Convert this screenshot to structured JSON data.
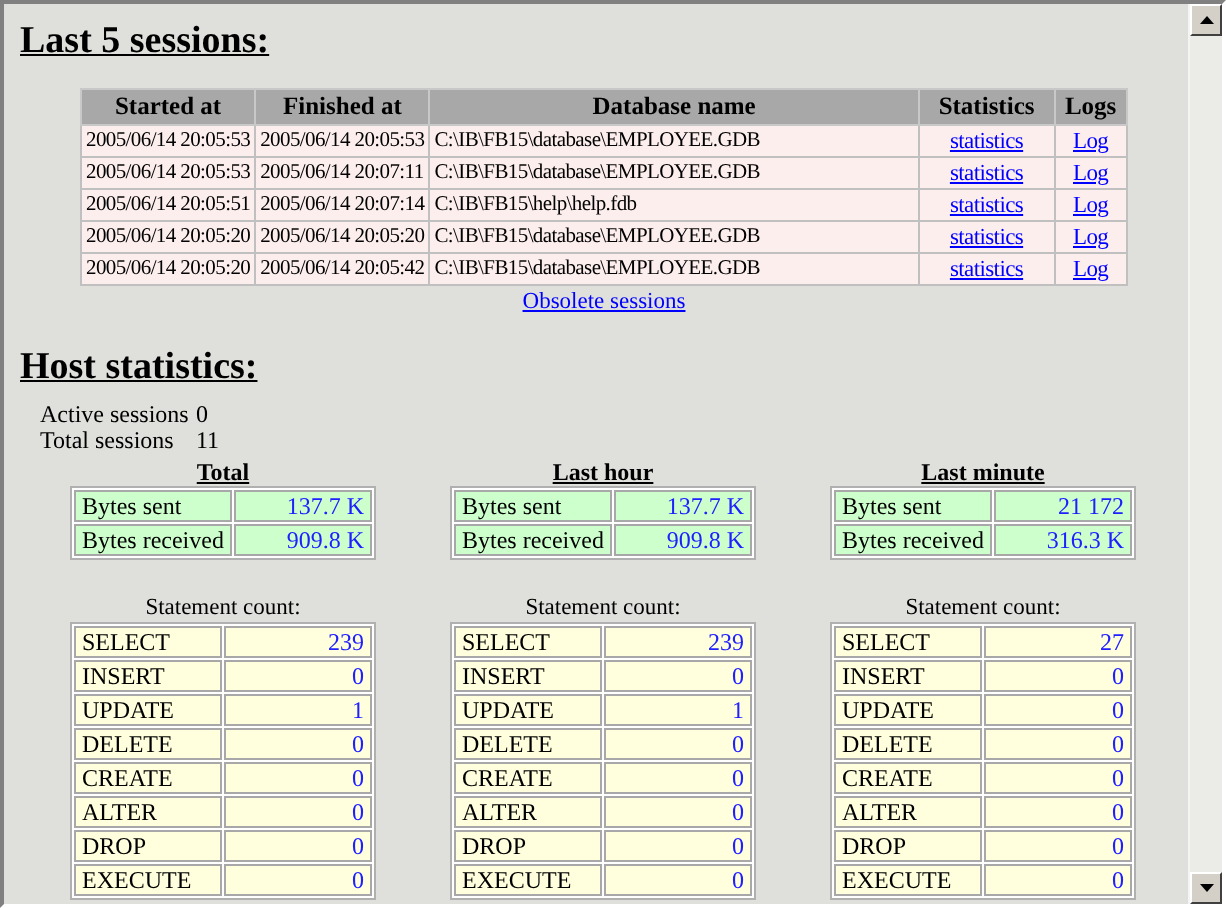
{
  "sessions": {
    "title": "Last 5 sessions:",
    "columns": [
      "Started at",
      "Finished at",
      "Database name",
      "Statistics",
      "Logs"
    ],
    "rows": [
      {
        "started": "2005/06/14 20:05:53",
        "finished": "2005/06/14 20:05:53",
        "database": "C:\\IB\\FB15\\database\\EMPLOYEE.GDB",
        "statistics": "statistics",
        "log": "Log"
      },
      {
        "started": "2005/06/14 20:05:53",
        "finished": "2005/06/14 20:07:11",
        "database": "C:\\IB\\FB15\\database\\EMPLOYEE.GDB",
        "statistics": "statistics",
        "log": "Log"
      },
      {
        "started": "2005/06/14 20:05:51",
        "finished": "2005/06/14 20:07:14",
        "database": "C:\\IB\\FB15\\help\\help.fdb",
        "statistics": "statistics",
        "log": "Log"
      },
      {
        "started": "2005/06/14 20:05:20",
        "finished": "2005/06/14 20:05:20",
        "database": "C:\\IB\\FB15\\database\\EMPLOYEE.GDB",
        "statistics": "statistics",
        "log": "Log"
      },
      {
        "started": "2005/06/14 20:05:20",
        "finished": "2005/06/14 20:05:42",
        "database": "C:\\IB\\FB15\\database\\EMPLOYEE.GDB",
        "statistics": "statistics",
        "log": "Log"
      }
    ],
    "footer_link": "Obsolete sessions"
  },
  "host": {
    "title": "Host statistics:",
    "summary": [
      {
        "label": "Active sessions",
        "value": "0"
      },
      {
        "label": "Total sessions",
        "value": "11"
      }
    ],
    "periods": [
      {
        "title": "Total",
        "traffic": [
          {
            "label": "Bytes sent",
            "value": "137.7 K"
          },
          {
            "label": "Bytes received",
            "value": "909.8 K"
          }
        ],
        "statement_title": "Statement count:",
        "statements": [
          {
            "label": "SELECT",
            "value": "239"
          },
          {
            "label": "INSERT",
            "value": "0"
          },
          {
            "label": "UPDATE",
            "value": "1"
          },
          {
            "label": "DELETE",
            "value": "0"
          },
          {
            "label": "CREATE",
            "value": "0"
          },
          {
            "label": "ALTER",
            "value": "0"
          },
          {
            "label": "DROP",
            "value": "0"
          },
          {
            "label": "EXECUTE",
            "value": "0"
          }
        ]
      },
      {
        "title": "Last hour",
        "traffic": [
          {
            "label": "Bytes sent",
            "value": "137.7 K"
          },
          {
            "label": "Bytes received",
            "value": "909.8 K"
          }
        ],
        "statement_title": "Statement count:",
        "statements": [
          {
            "label": "SELECT",
            "value": "239"
          },
          {
            "label": "INSERT",
            "value": "0"
          },
          {
            "label": "UPDATE",
            "value": "1"
          },
          {
            "label": "DELETE",
            "value": "0"
          },
          {
            "label": "CREATE",
            "value": "0"
          },
          {
            "label": "ALTER",
            "value": "0"
          },
          {
            "label": "DROP",
            "value": "0"
          },
          {
            "label": "EXECUTE",
            "value": "0"
          }
        ]
      },
      {
        "title": "Last minute",
        "traffic": [
          {
            "label": "Bytes sent",
            "value": "21 172"
          },
          {
            "label": "Bytes received",
            "value": "316.3 K"
          }
        ],
        "statement_title": "Statement count:",
        "statements": [
          {
            "label": "SELECT",
            "value": "27"
          },
          {
            "label": "INSERT",
            "value": "0"
          },
          {
            "label": "UPDATE",
            "value": "0"
          },
          {
            "label": "DELETE",
            "value": "0"
          },
          {
            "label": "CREATE",
            "value": "0"
          },
          {
            "label": "ALTER",
            "value": "0"
          },
          {
            "label": "DROP",
            "value": "0"
          },
          {
            "label": "EXECUTE",
            "value": "0"
          }
        ]
      }
    ]
  }
}
